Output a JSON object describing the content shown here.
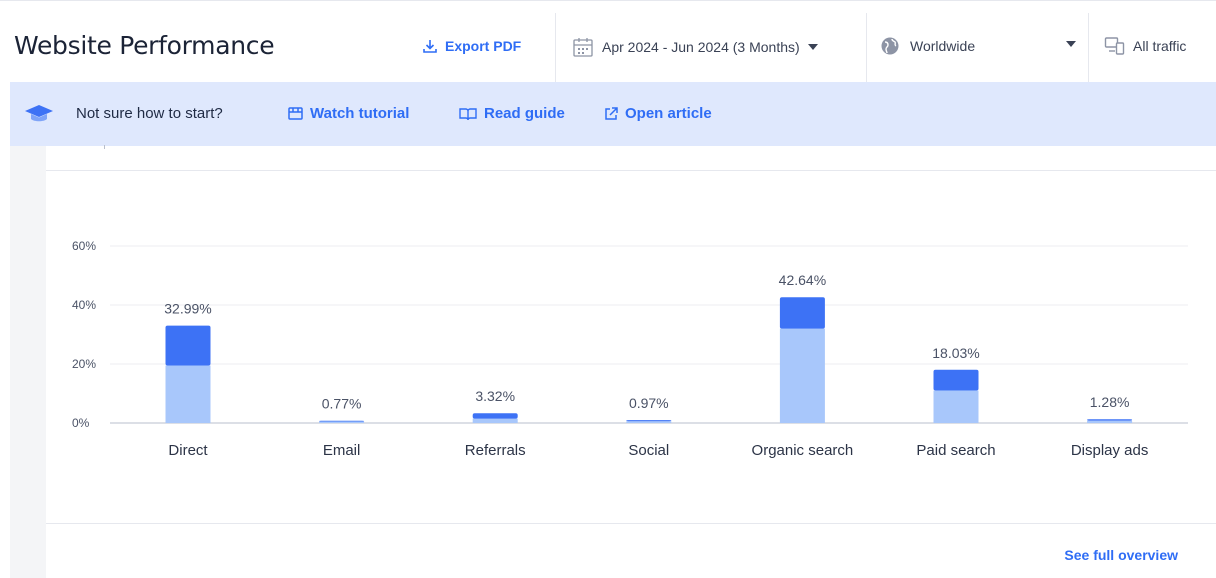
{
  "header": {
    "title": "Website Performance",
    "export_label": "Export PDF",
    "date_range": "Apr 2024 - Jun 2024 (3 Months)",
    "region": "Worldwide",
    "traffic": "All traffic"
  },
  "banner": {
    "question": "Not sure how to start?",
    "watch": "Watch tutorial",
    "read": "Read guide",
    "open": "Open article"
  },
  "footer": {
    "see_full": "See full overview"
  },
  "colors": {
    "accent": "#2f6df5",
    "bar_dark": "#3d72f5",
    "bar_light": "#a8c7fb",
    "banner_bg": "#dfe8fd"
  },
  "chart_data": {
    "type": "bar",
    "stacked": true,
    "categories": [
      "Direct",
      "Email",
      "Referrals",
      "Social",
      "Organic search",
      "Paid search",
      "Display ads"
    ],
    "labels": [
      "32.99%",
      "0.77%",
      "3.32%",
      "0.97%",
      "42.64%",
      "18.03%",
      "1.28%"
    ],
    "series": [
      {
        "values": [
          19.5,
          0.5,
          1.5,
          0.6,
          32.0,
          11.0,
          0.8
        ]
      },
      {
        "values": [
          13.49,
          0.27,
          1.82,
          0.37,
          10.64,
          7.03,
          0.48
        ]
      }
    ],
    "ylim": [
      0,
      60
    ],
    "yticks": [
      "0%",
      "20%",
      "40%",
      "60%"
    ],
    "grid": true
  }
}
